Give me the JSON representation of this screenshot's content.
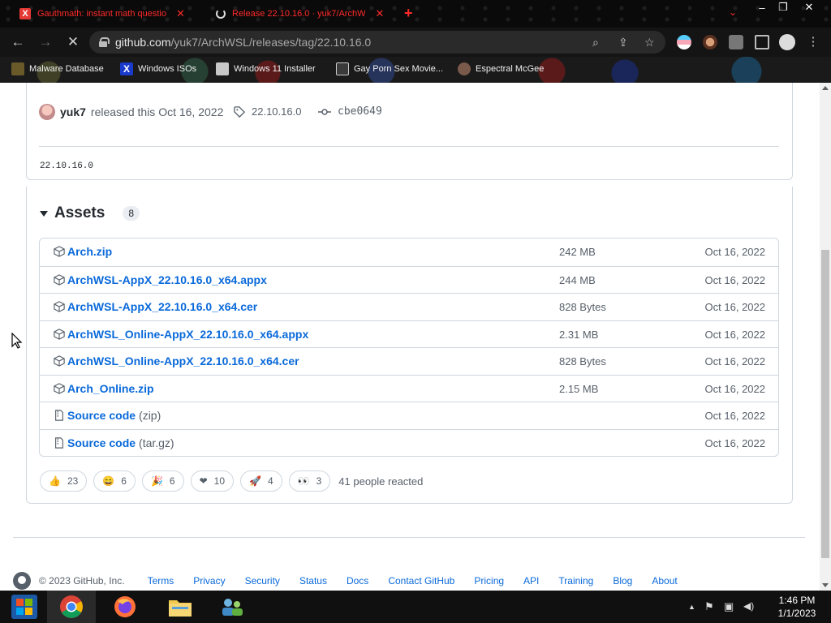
{
  "browser": {
    "tabs": [
      {
        "title": "Gauthmath: instant math questio",
        "icon": "gauthmath-favicon",
        "icon_glyph": "X"
      },
      {
        "title": "Release 22.10.16.0 · yuk7/ArchW",
        "icon": "loading-spinner-icon"
      }
    ],
    "new_tab_glyph": "+",
    "tab_search_glyph": "⌄",
    "window_controls": {
      "minimize": "–",
      "restore": "❐",
      "close": "✕"
    },
    "nav": {
      "back": "←",
      "forward": "→",
      "reload": "✕"
    },
    "address": {
      "host": "github.com",
      "path": "/yuk7/ArchWSL/releases/tag/22.10.16.0"
    },
    "omnibox_icons": {
      "search": "⌕",
      "share": "⇪",
      "bookmark": "☆"
    },
    "bookmarks": [
      {
        "label": "Malware Database",
        "icon": "malware-icon"
      },
      {
        "label": "Windows ISOs",
        "icon": "x-logo-icon",
        "glyph": "X"
      },
      {
        "label": "Windows 11 Installer",
        "icon": "installer-icon"
      },
      {
        "label": "Gay Porn Sex Movie...",
        "icon": "site-icon"
      },
      {
        "label": "Espectral McGee",
        "icon": "ghost-icon"
      }
    ]
  },
  "release": {
    "author": "yuk7",
    "released_text": "released this Oct 16, 2022",
    "tag": "22.10.16.0",
    "commit": "cbe0649",
    "body": "22.10.16.0"
  },
  "assets": {
    "title": "Assets",
    "count": "8",
    "items": [
      {
        "name": "Arch.zip",
        "size": "242 MB",
        "date": "Oct 16, 2022",
        "icon": "package-icon"
      },
      {
        "name": "ArchWSL-AppX_22.10.16.0_x64.appx",
        "size": "244 MB",
        "date": "Oct 16, 2022",
        "icon": "package-icon"
      },
      {
        "name": "ArchWSL-AppX_22.10.16.0_x64.cer",
        "size": "828 Bytes",
        "date": "Oct 16, 2022",
        "icon": "package-icon"
      },
      {
        "name": "ArchWSL_Online-AppX_22.10.16.0_x64.appx",
        "size": "2.31 MB",
        "date": "Oct 16, 2022",
        "icon": "package-icon"
      },
      {
        "name": "ArchWSL_Online-AppX_22.10.16.0_x64.cer",
        "size": "828 Bytes",
        "date": "Oct 16, 2022",
        "icon": "package-icon"
      },
      {
        "name": "Arch_Online.zip",
        "size": "2.15 MB",
        "date": "Oct 16, 2022",
        "icon": "package-icon"
      },
      {
        "name": "Source code",
        "format": "(zip)",
        "size": "",
        "date": "Oct 16, 2022",
        "icon": "file-zip-icon"
      },
      {
        "name": "Source code",
        "format": "(tar.gz)",
        "size": "",
        "date": "Oct 16, 2022",
        "icon": "file-zip-icon"
      }
    ]
  },
  "reactions": {
    "items": [
      {
        "emoji": "👍",
        "count": "23",
        "icon": "thumbs-up-icon"
      },
      {
        "emoji": "😄",
        "count": "6",
        "icon": "laugh-icon"
      },
      {
        "emoji": "🎉",
        "count": "6",
        "icon": "hooray-icon"
      },
      {
        "emoji": "❤",
        "count": "10",
        "icon": "heart-icon"
      },
      {
        "emoji": "🚀",
        "count": "4",
        "icon": "rocket-icon"
      },
      {
        "emoji": "👀",
        "count": "3",
        "icon": "eyes-icon"
      }
    ],
    "summary": "41 people reacted"
  },
  "footer": {
    "copyright": "© 2023 GitHub, Inc.",
    "links": [
      "Terms",
      "Privacy",
      "Security",
      "Status",
      "Docs",
      "Contact GitHub",
      "Pricing",
      "API",
      "Training",
      "Blog",
      "About"
    ]
  },
  "taskbar": {
    "apps": [
      "start-button",
      "chrome-app",
      "firefox-app",
      "file-explorer-app",
      "network-app"
    ],
    "time": "1:46 PM",
    "date": "1/1/2023",
    "tray_glyphs": {
      "chevron": "▲",
      "flag": "⚑",
      "network": "▣",
      "volume": "◀)"
    }
  },
  "colors": {
    "link": "#0969da",
    "muted": "#57606a",
    "border": "#d0d7de",
    "tab_text": "#ff2a2a"
  }
}
